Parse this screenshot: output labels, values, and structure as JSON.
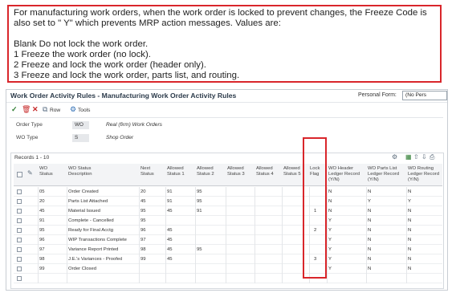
{
  "callout": {
    "line1": "For manufacturing work orders, when the work order is locked to prevent changes, the Freeze Code is also set to \" Y\" which prevents MRP action messages. Values are:",
    "line2": "Blank Do not lock the work order.",
    "line3": "1 Freeze the work order (no lock).",
    "line4": "2 Freeze and lock the work order (header only).",
    "line5": "3 Freeze and lock the work order, parts list, and routing."
  },
  "app": {
    "title": "Work Order Activity Rules - Manufacturing Work Order Activity Rules",
    "personal_form_label": "Personal Form:",
    "personal_form_value": "(No Pers",
    "toolbar": {
      "row_label": "Row",
      "tools_label": "Tools"
    },
    "fields": {
      "order_type_label": "Order Type",
      "order_type_code": "WO",
      "order_type_desc": "Real (firm) Work Orders",
      "wo_type_label": "WO Type",
      "wo_type_code": "S",
      "wo_type_desc": "Shop Order"
    },
    "records_label": "Records 1 - 10"
  },
  "grid": {
    "headers": {
      "status": [
        "WO",
        "Status"
      ],
      "desc": [
        "WO Status",
        "Description"
      ],
      "next": [
        "Next",
        "Status"
      ],
      "a1": [
        "Allowed",
        "Status 1"
      ],
      "a2": [
        "Allowed",
        "Status 2"
      ],
      "a3": [
        "Allowed",
        "Status 3"
      ],
      "a4": [
        "Allowed",
        "Status 4"
      ],
      "a5": [
        "Allowed",
        "Status 5"
      ],
      "lock": [
        "Lock",
        "Flag"
      ],
      "hdr": [
        "WO Header",
        "Ledger Record",
        "(Y/N)"
      ],
      "parts": [
        "WO Parts List",
        "Ledger Record",
        "(Y/N)"
      ],
      "routing": [
        "WO Routing",
        "Ledger Record",
        "(Y/N)"
      ]
    },
    "rows": [
      {
        "status": "05",
        "desc": "Order Created",
        "next": "20",
        "a1": "91",
        "a2": "95",
        "a3": "",
        "a4": "",
        "a5": "",
        "lock": "",
        "hdr": "N",
        "parts": "N",
        "routing": "N"
      },
      {
        "status": "20",
        "desc": "Parts List Attached",
        "next": "45",
        "a1": "91",
        "a2": "95",
        "a3": "",
        "a4": "",
        "a5": "",
        "lock": "",
        "hdr": "N",
        "parts": "Y",
        "routing": "Y"
      },
      {
        "status": "45",
        "desc": "Material Issued",
        "next": "95",
        "a1": "45",
        "a2": "91",
        "a3": "",
        "a4": "",
        "a5": "",
        "lock": "1",
        "hdr": "N",
        "parts": "N",
        "routing": "N"
      },
      {
        "status": "91",
        "desc": "Complete - Cancelled",
        "next": "95",
        "a1": "",
        "a2": "",
        "a3": "",
        "a4": "",
        "a5": "",
        "lock": "",
        "hdr": "Y",
        "parts": "N",
        "routing": "N"
      },
      {
        "status": "95",
        "desc": "Ready for Final Acctg",
        "next": "96",
        "a1": "45",
        "a2": "",
        "a3": "",
        "a4": "",
        "a5": "",
        "lock": "2",
        "hdr": "Y",
        "parts": "N",
        "routing": "N"
      },
      {
        "status": "96",
        "desc": "WIP Transactions Complete",
        "next": "97",
        "a1": "45",
        "a2": "",
        "a3": "",
        "a4": "",
        "a5": "",
        "lock": "",
        "hdr": "Y",
        "parts": "N",
        "routing": "N"
      },
      {
        "status": "97",
        "desc": "Variance Report Printed",
        "next": "98",
        "a1": "45",
        "a2": "95",
        "a3": "",
        "a4": "",
        "a5": "",
        "lock": "",
        "hdr": "Y",
        "parts": "N",
        "routing": "N"
      },
      {
        "status": "98",
        "desc": "J.E.'s Variances - Proofed",
        "next": "99",
        "a1": "45",
        "a2": "",
        "a3": "",
        "a4": "",
        "a5": "",
        "lock": "3",
        "hdr": "Y",
        "parts": "N",
        "routing": "N"
      },
      {
        "status": "99",
        "desc": "Order Closed",
        "next": "",
        "a1": "",
        "a2": "",
        "a3": "",
        "a4": "",
        "a5": "",
        "lock": "",
        "hdr": "Y",
        "parts": "N",
        "routing": "N"
      },
      {
        "status": "",
        "desc": "",
        "next": "",
        "a1": "",
        "a2": "",
        "a3": "",
        "a4": "",
        "a5": "",
        "lock": "",
        "hdr": "",
        "parts": "",
        "routing": ""
      }
    ]
  },
  "colors": {
    "highlight": "#d9262b",
    "header_bg": "#f3f4f6"
  },
  "icons": [
    "ok-check-icon",
    "delete-trash-icon",
    "cancel-x-icon",
    "copy-icon",
    "tools-gear-icon",
    "grid-settings-icon",
    "export-excel-icon",
    "upload-icon",
    "download-icon",
    "print-icon",
    "attachment-icon"
  ]
}
